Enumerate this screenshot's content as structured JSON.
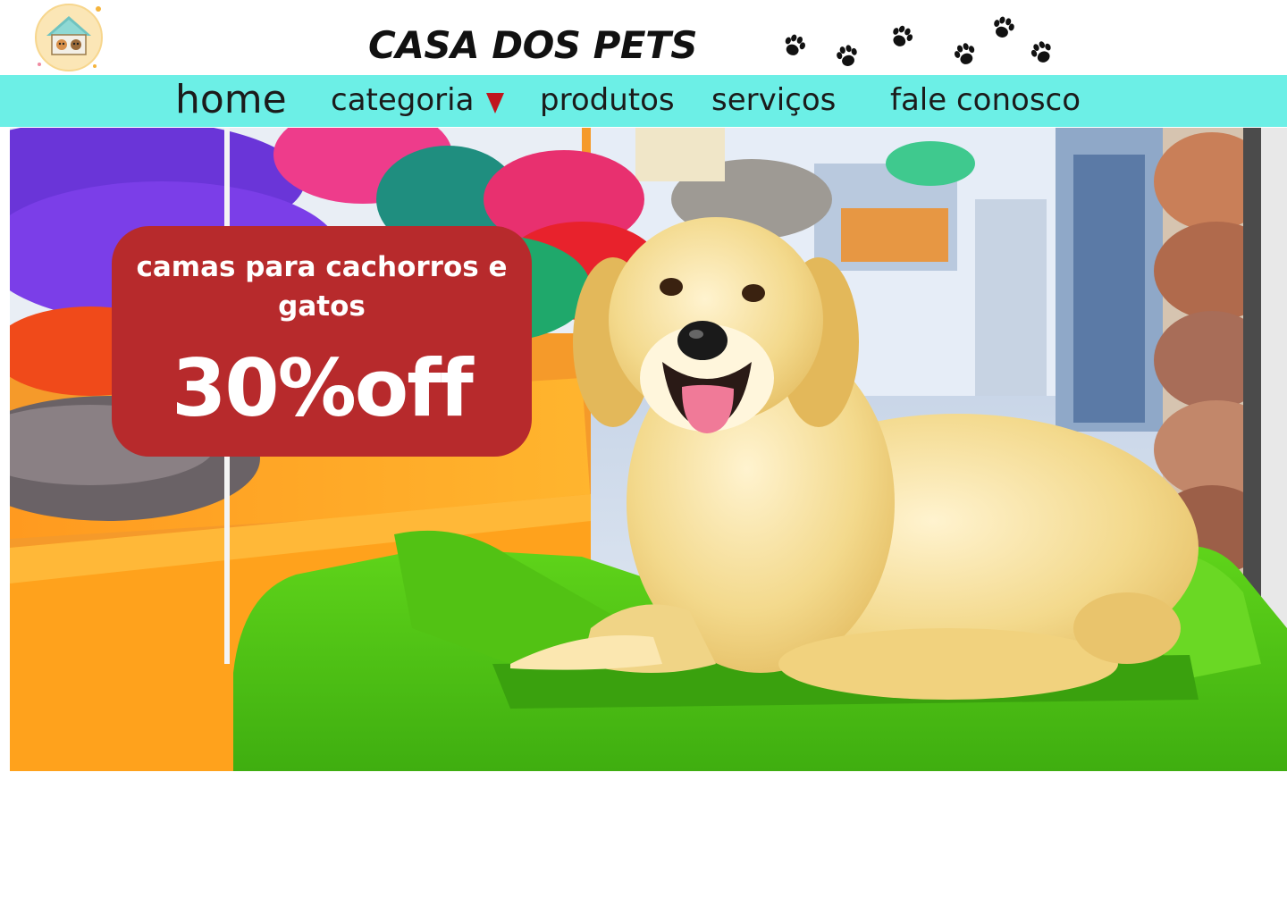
{
  "header": {
    "site_title": "CASA DOS PETS",
    "logo_icon": "house-with-pets-icon",
    "paw_icon": "paw-print-icon"
  },
  "nav": {
    "items": [
      {
        "label": "home"
      },
      {
        "label": "categoria"
      },
      {
        "label": "produtos"
      },
      {
        "label": "serviços"
      },
      {
        "label": "fale conosco"
      }
    ],
    "dropdown_icon": "caret-down-icon"
  },
  "hero": {
    "promo_title": "camas para cachorros e gatos",
    "promo_discount": "30%off"
  },
  "colors": {
    "nav_background": "#6cefe6",
    "promo_background": "#b72a2c",
    "caret": "#c0161e",
    "title_text": "#111111",
    "page_background": "#ffffff"
  }
}
